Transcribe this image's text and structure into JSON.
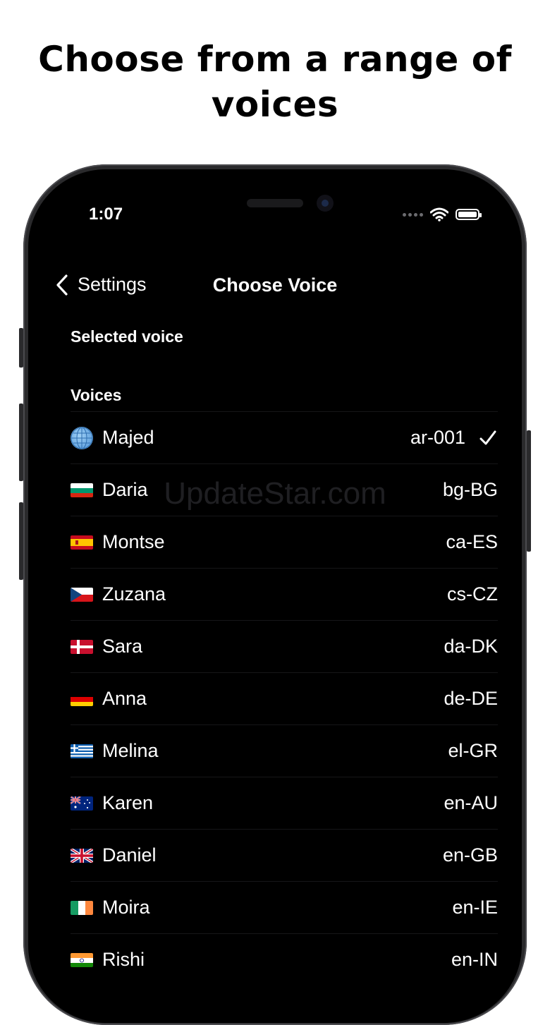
{
  "headline": {
    "line1": "Choose from a range of",
    "line2": "voices"
  },
  "status_bar": {
    "time": "1:07"
  },
  "nav": {
    "back_label": "Settings",
    "title": "Choose Voice"
  },
  "sections": {
    "selected_label": "Selected voice",
    "voices_label": "Voices"
  },
  "watermark": "UpdateStar.com",
  "voices": [
    {
      "name": "Majed",
      "code": "ar-001",
      "icon": "globe-icon",
      "selected": true
    },
    {
      "name": "Daria",
      "code": "bg-BG",
      "icon": "bulgaria-flag-icon",
      "selected": false
    },
    {
      "name": "Montse",
      "code": "ca-ES",
      "icon": "spain-flag-icon",
      "selected": false
    },
    {
      "name": "Zuzana",
      "code": "cs-CZ",
      "icon": "czech-flag-icon",
      "selected": false
    },
    {
      "name": "Sara",
      "code": "da-DK",
      "icon": "denmark-flag-icon",
      "selected": false
    },
    {
      "name": "Anna",
      "code": "de-DE",
      "icon": "germany-flag-icon",
      "selected": false
    },
    {
      "name": "Melina",
      "code": "el-GR",
      "icon": "greece-flag-icon",
      "selected": false
    },
    {
      "name": "Karen",
      "code": "en-AU",
      "icon": "australia-flag-icon",
      "selected": false
    },
    {
      "name": "Daniel",
      "code": "en-GB",
      "icon": "uk-flag-icon",
      "selected": false
    },
    {
      "name": "Moira",
      "code": "en-IE",
      "icon": "ireland-flag-icon",
      "selected": false
    },
    {
      "name": "Rishi",
      "code": "en-IN",
      "icon": "india-flag-icon",
      "selected": false
    }
  ]
}
